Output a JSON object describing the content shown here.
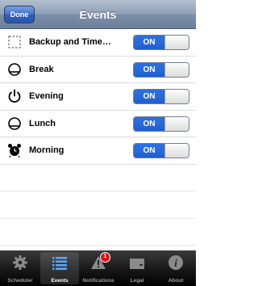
{
  "navbar": {
    "title": "Events",
    "done_label": "Done"
  },
  "events": [
    {
      "label": "Backup and Time…",
      "icon": "dashed-square-icon",
      "toggle": "ON"
    },
    {
      "label": "Break",
      "icon": "bowl-icon",
      "toggle": "ON"
    },
    {
      "label": "Evening",
      "icon": "power-icon",
      "toggle": "ON"
    },
    {
      "label": "Lunch",
      "icon": "bowl-icon",
      "toggle": "ON"
    },
    {
      "label": "Morning",
      "icon": "alarm-clock-icon",
      "toggle": "ON"
    }
  ],
  "tabbar": {
    "tabs": [
      {
        "label": "Scheduler",
        "icon": "gear-icon"
      },
      {
        "label": "Events",
        "icon": "list-icon"
      },
      {
        "label": "Notifications",
        "icon": "warning-icon",
        "badge": "1"
      },
      {
        "label": "Legal",
        "icon": "folder-icon"
      },
      {
        "label": "About",
        "icon": "info-icon"
      }
    ],
    "active": "Events"
  }
}
